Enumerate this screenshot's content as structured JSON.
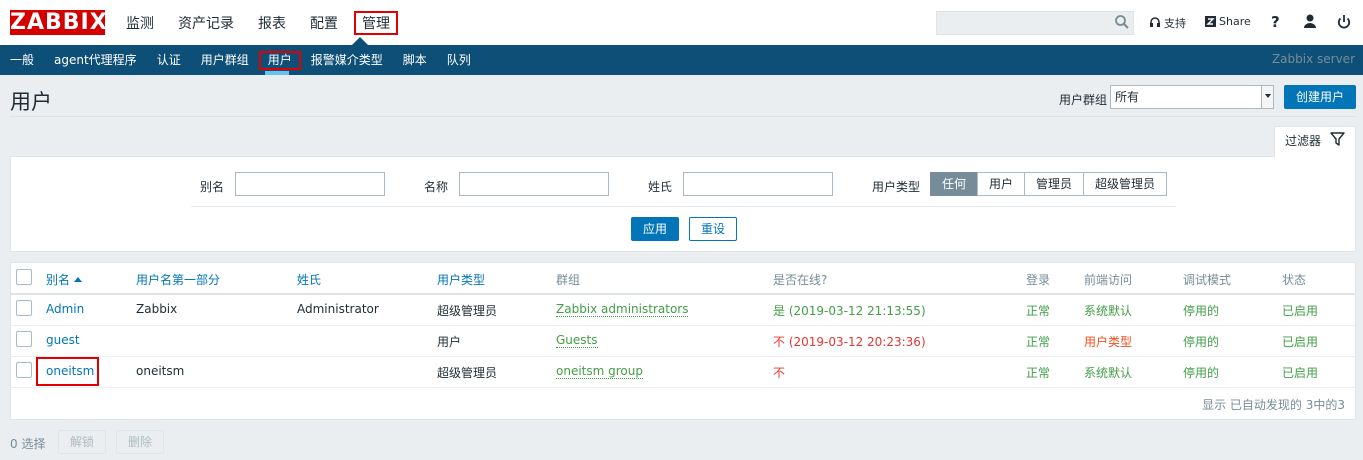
{
  "header": {
    "logo_text": "ZABBIX",
    "main_menu": [
      "监测",
      "资产记录",
      "报表",
      "配置",
      "管理"
    ],
    "search_value": "",
    "support_label": "支持",
    "share_label": "Share",
    "help_label": "?"
  },
  "sub_menu": {
    "items": [
      "一般",
      "agent代理程序",
      "认证",
      "用户群组",
      "用户",
      "报警媒介类型",
      "脚本",
      "队列"
    ],
    "server_name": "Zabbix server"
  },
  "page": {
    "title": "用户",
    "group_label": "用户群组",
    "group_selected": "所有",
    "create_button": "创建用户"
  },
  "filter": {
    "tab_label": "过滤器",
    "alias_label": "别名",
    "alias_value": "",
    "name_label": "名称",
    "name_value": "",
    "surname_label": "姓氏",
    "surname_value": "",
    "type_label": "用户类型",
    "type_options": [
      "任何",
      "用户",
      "管理员",
      "超级管理员"
    ],
    "type_selected": "任何",
    "apply_button": "应用",
    "reset_button": "重设"
  },
  "table": {
    "columns": [
      "别名",
      "用户名第一部分",
      "姓氏",
      "用户类型",
      "群组",
      "是否在线?",
      "登录",
      "前端访问",
      "调试模式",
      "状态"
    ],
    "rows": [
      {
        "alias": "Admin",
        "name": "Zabbix",
        "surname": "Administrator",
        "type": "超级管理员",
        "groups": "Zabbix administrators",
        "online": "是 (2019-03-12 21:13:55)",
        "login": "正常",
        "frontend": "系统默认",
        "debug": "停用的",
        "status": "已启用"
      },
      {
        "alias": "guest",
        "name": "",
        "surname": "",
        "type": "用户",
        "groups": "Guests",
        "online": "不 (2019-03-12 20:23:36)",
        "login": "正常",
        "frontend": "用户类型",
        "debug": "停用的",
        "status": "已启用"
      },
      {
        "alias": "oneitsm",
        "name": "oneitsm",
        "surname": "",
        "type": "超级管理员",
        "groups": "oneitsm group",
        "online": "不",
        "login": "正常",
        "frontend": "系统默认",
        "debug": "停用的",
        "status": "已启用"
      }
    ],
    "paging_text": "显示 已自动发现的 3中的3"
  },
  "footer": {
    "selected_text": "0 选择",
    "unlock_button": "解锁",
    "delete_button": "删除"
  },
  "colors": {
    "brand_red": "#d40000",
    "nav_blue": "#0e4f78",
    "link_blue": "#0275b8",
    "status_green": "#429e47",
    "status_red": "#e33734",
    "status_orange": "#f24f1d"
  }
}
